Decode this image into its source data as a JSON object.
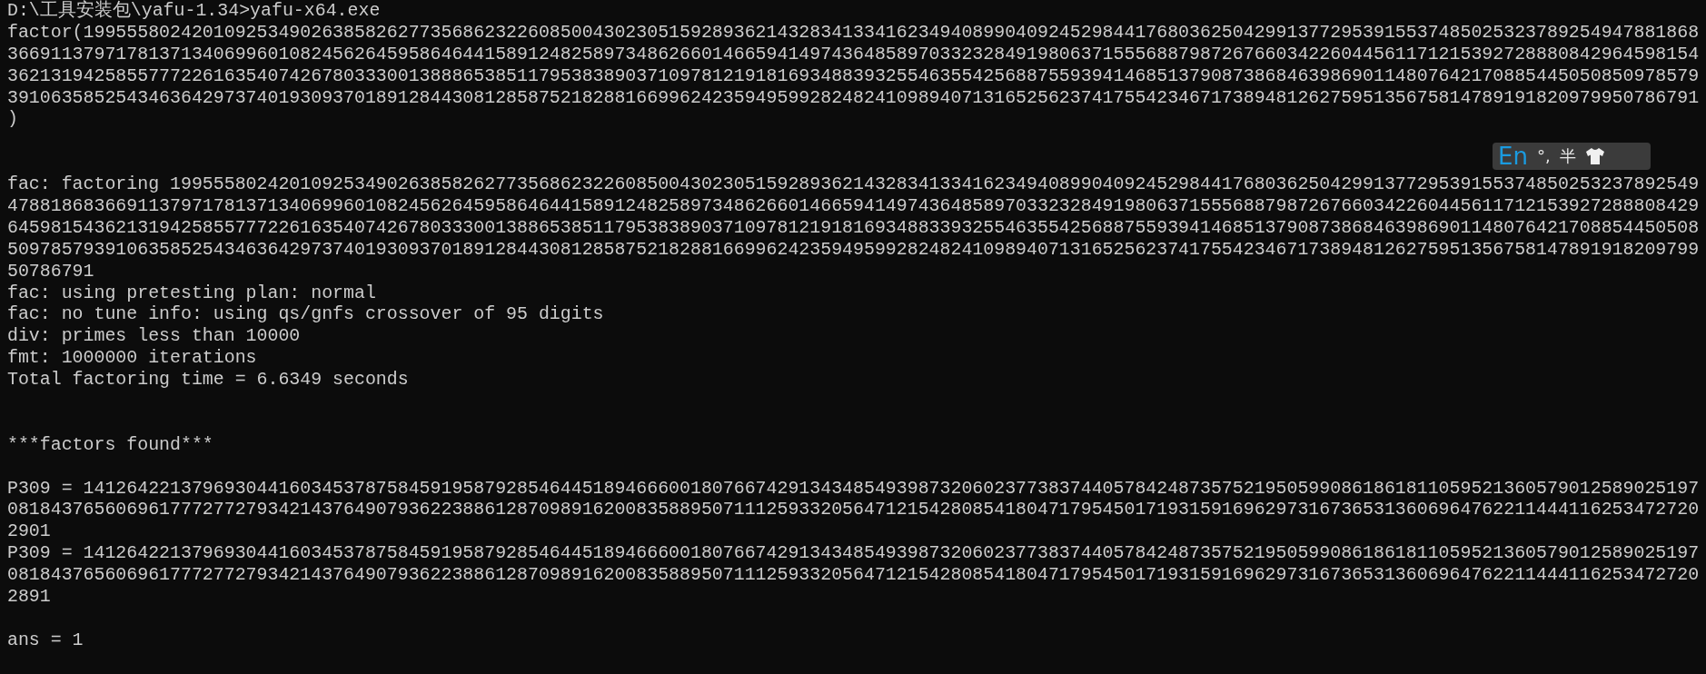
{
  "terminal": {
    "lines": [
      {
        "kind": "text",
        "text": "D:\\工具安装包\\yafu-1.34>yafu-x64.exe"
      },
      {
        "kind": "text",
        "text": "factor(19955580242010925349026385826277356862322608500430230515928936214328341334162349408990409245298441768036250429913772953915537485025323789254947881868"
      },
      {
        "kind": "text",
        "text": "366911379717813713406996010824562645958646441589124825897348626601466594149743648589703323284919806371555688798726766034226044561171215392728880842964598154"
      },
      {
        "kind": "text",
        "text": "362131942585577722616354074267803330013888653851179538389037109781219181693488393255463554256887559394146851379087386846398690114807642170885445050850978579"
      },
      {
        "kind": "text",
        "text": "391063585254346364297374019309370189128443081285875218288166996242359495992824824109894071316525623741755423467173894812627595135675814789191820979950786791"
      },
      {
        "kind": "text",
        "text": ")"
      },
      {
        "kind": "blank"
      },
      {
        "kind": "blank"
      },
      {
        "kind": "text",
        "text": "fac: factoring 199555802420109253490263858262773568623226085004302305159289362143283413341623494089904092452984417680362504299137729539155374850253237892549"
      },
      {
        "kind": "text",
        "text": "478818683669113797178137134069960108245626459586464415891248258973486266014665941497436485897033232849198063715556887987267660342260445611712153927288808429"
      },
      {
        "kind": "text",
        "text": "645981543621319425855777226163540742678033300138865385117953838903710978121918169348833932554635542568875593941468513790873868463986901148076421708854450508"
      },
      {
        "kind": "text",
        "text": "509785793910635852543463642973740193093701891284430812858752182881669962423594959928248241098940713165256237417554234671738948126275951356758147891918209799"
      },
      {
        "kind": "text",
        "text": "50786791"
      },
      {
        "kind": "text",
        "text": "fac: using pretesting plan: normal"
      },
      {
        "kind": "text",
        "text": "fac: no tune info: using qs/gnfs crossover of 95 digits"
      },
      {
        "kind": "text",
        "text": "div: primes less than 10000"
      },
      {
        "kind": "text",
        "text": "fmt: 1000000 iterations"
      },
      {
        "kind": "text",
        "text": "Total factoring time = 6.6349 seconds"
      },
      {
        "kind": "blank"
      },
      {
        "kind": "blank"
      },
      {
        "kind": "text",
        "text": "***factors found***"
      },
      {
        "kind": "blank"
      },
      {
        "kind": "text",
        "text": "P309 = 14126422137969304416034537875845919587928546445189466600180766742913434854939873206023773837440578424873575219505990861861811059521360579012589025197"
      },
      {
        "kind": "text",
        "text": "081843765606961777277279342143764907936223886128709891620083588950711125933205647121542808541804717954501719315916962973167365313606964762211444116253472720"
      },
      {
        "kind": "text",
        "text": "2901"
      },
      {
        "kind": "text",
        "text": "P309 = 14126422137969304416034537875845919587928546445189466600180766742913434854939873206023773837440578424873575219505990861861811059521360579012589025197"
      },
      {
        "kind": "text",
        "text": "081843765606961777277279342143764907936223886128709891620083588950711125933205647121542808541804717954501719315916962973167365313606964762211444116253472720"
      },
      {
        "kind": "text",
        "text": "2891"
      },
      {
        "kind": "blank"
      },
      {
        "kind": "text",
        "text": "ans = 1"
      }
    ]
  },
  "ime_indicator": {
    "mode": "En",
    "punctuation": "°,",
    "width": "半"
  }
}
